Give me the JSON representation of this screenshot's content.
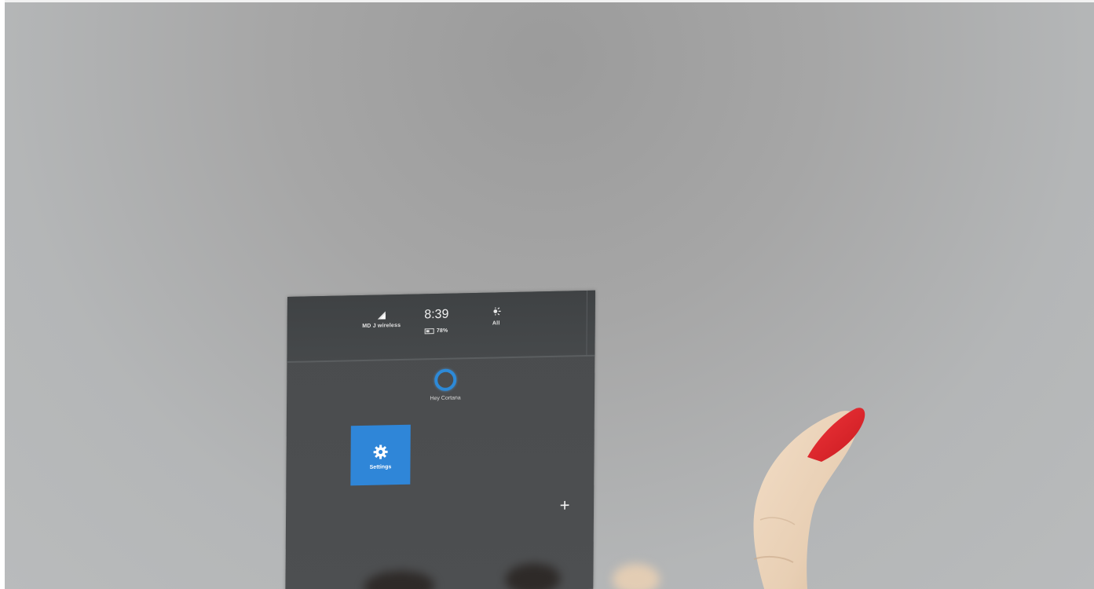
{
  "status": {
    "wifi_label": "MD J wireless",
    "time": "8:39",
    "battery": "78%",
    "brightness_label": "All"
  },
  "cortana": {
    "label": "Hey Cortana"
  },
  "tiles": [
    {
      "label": "Settings",
      "icon": "gear-icon"
    }
  ],
  "add_button": {
    "label": "+"
  },
  "colors": {
    "tile_blue": "#2f86d8",
    "cortana_blue": "#2d8ad8",
    "panel": "#4a4c4e",
    "nail_red": "#e5222a"
  }
}
